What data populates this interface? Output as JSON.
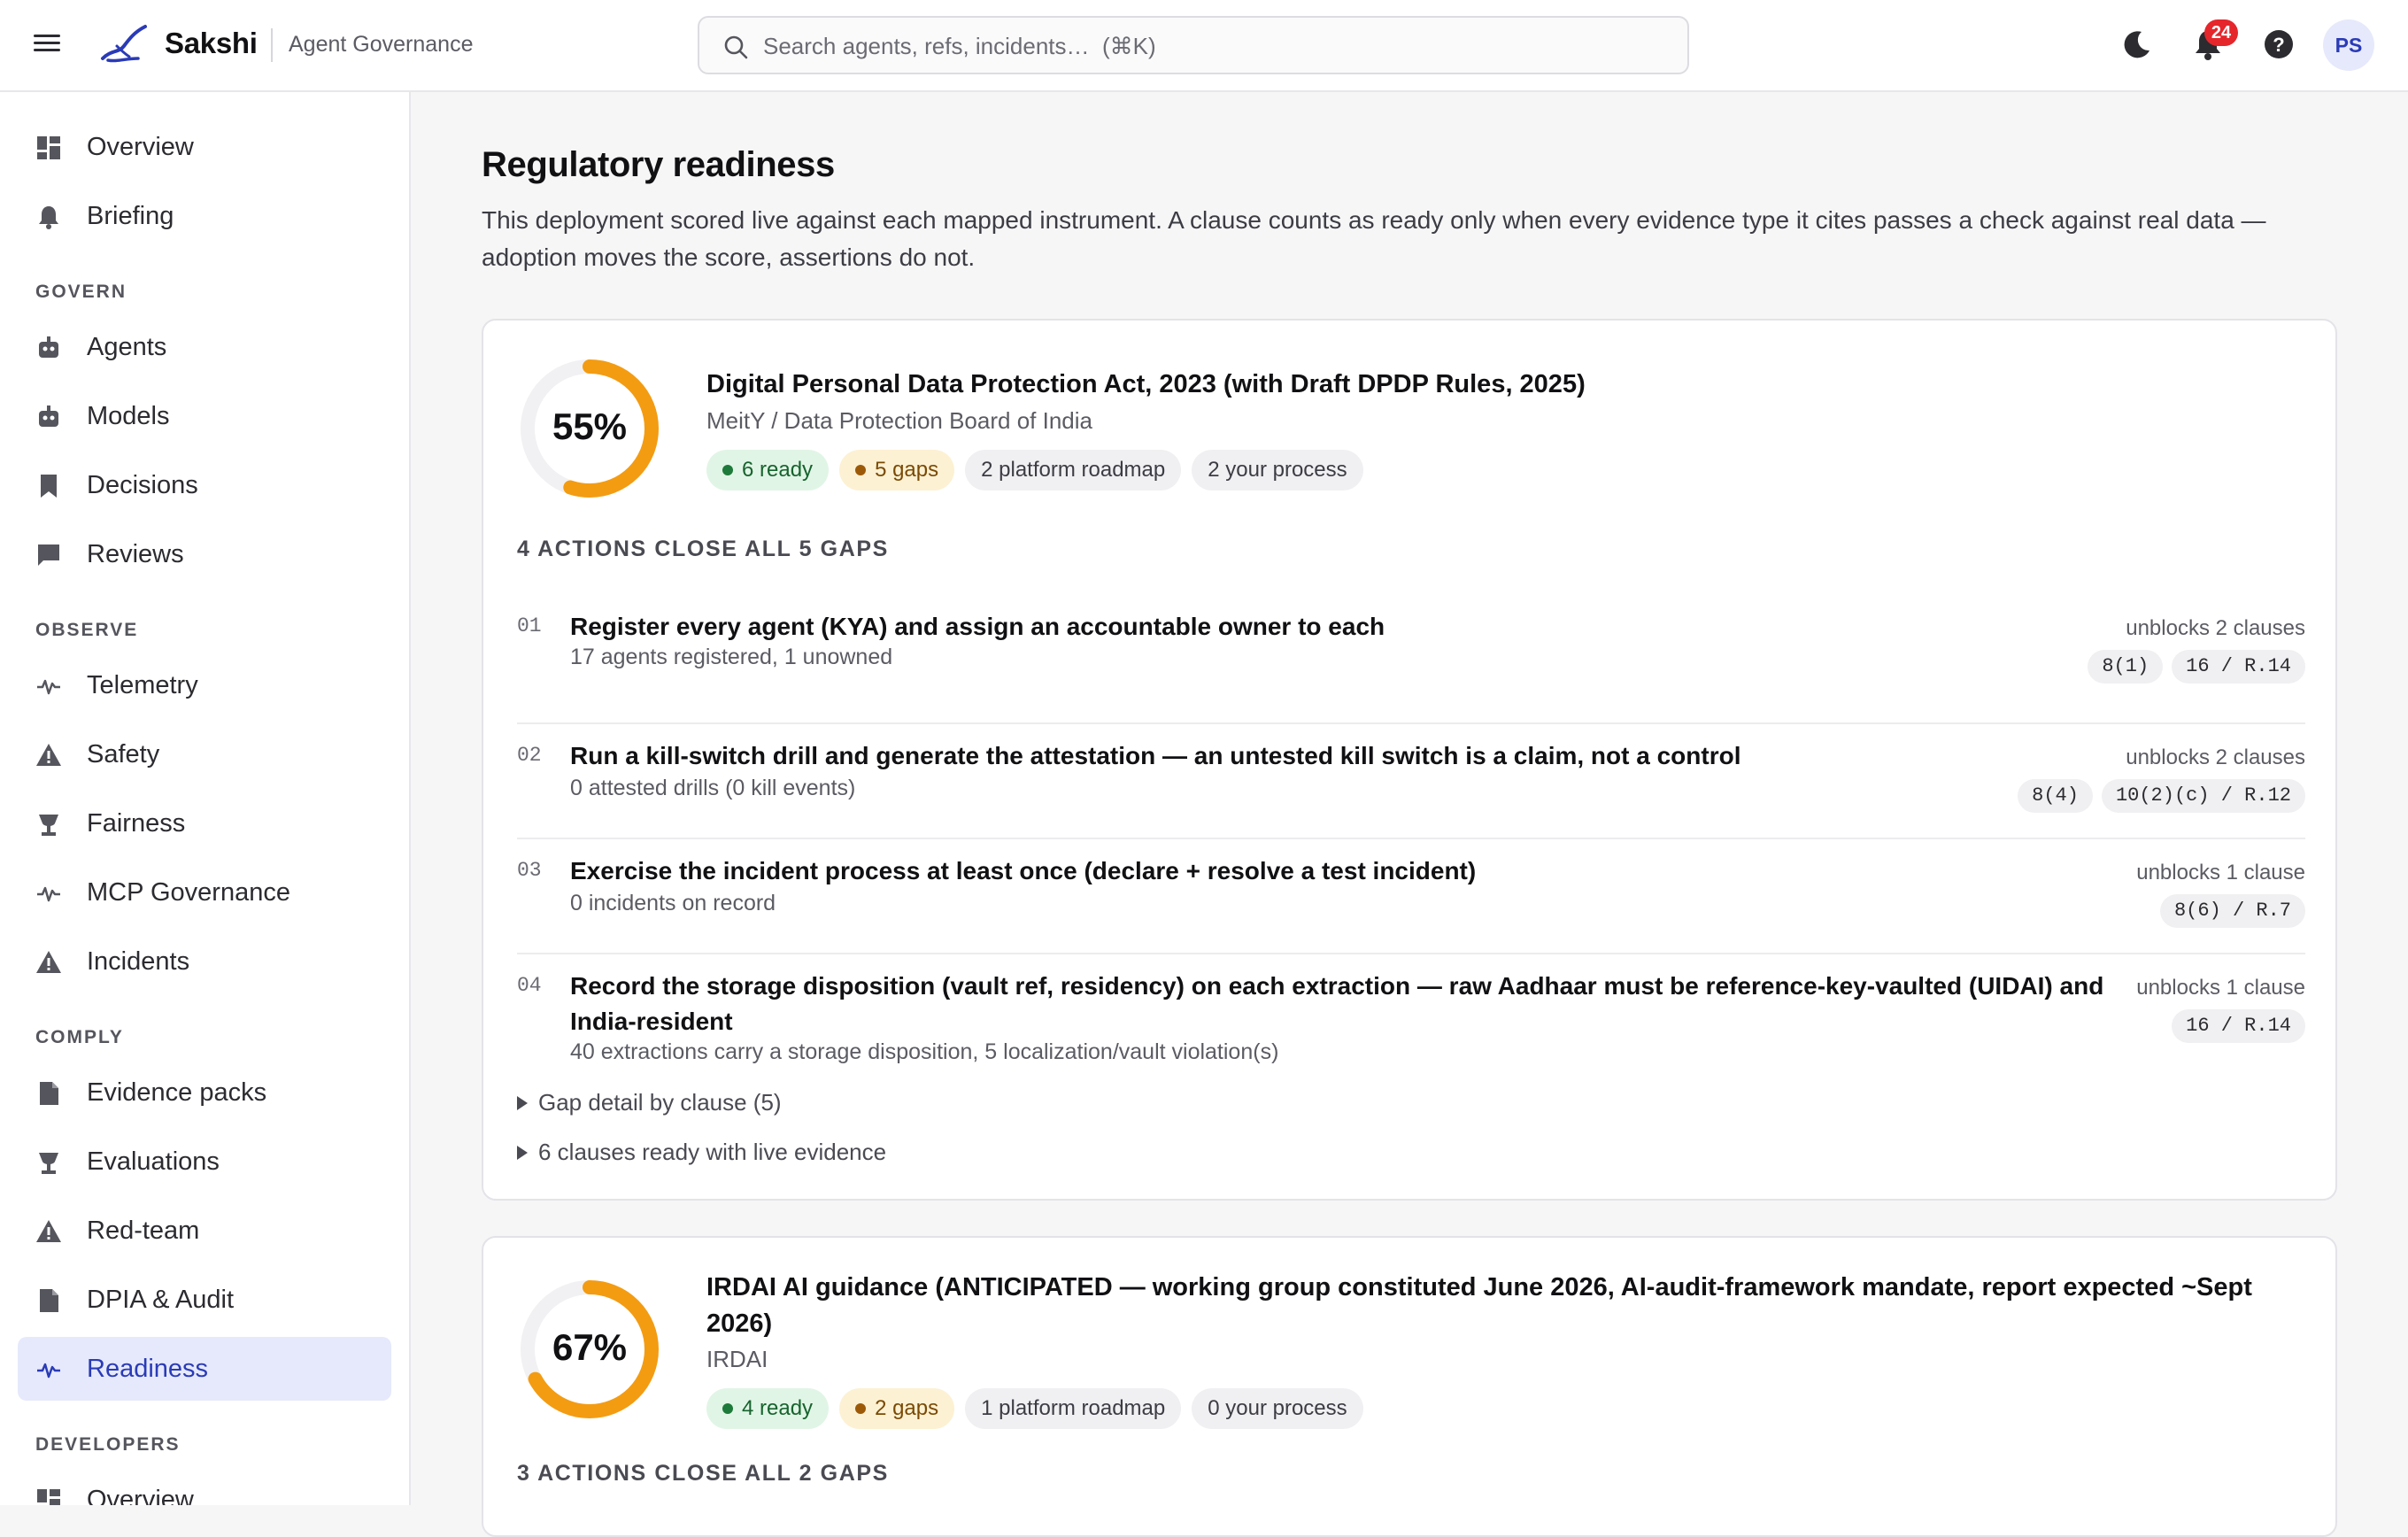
{
  "app": {
    "brand": "Sakshi",
    "subtitle": "Agent Governance"
  },
  "search": {
    "placeholder": "Search agents, refs, incidents…  (⌘K)"
  },
  "topbar": {
    "notification_count": "24",
    "avatar_initials": "PS"
  },
  "sidebar": {
    "top_items": [
      {
        "label": "Overview",
        "icon": "dashboard-icon"
      },
      {
        "label": "Briefing",
        "icon": "bell-icon"
      }
    ],
    "sections": [
      {
        "title": "GOVERN",
        "items": [
          {
            "label": "Agents",
            "icon": "robot-icon"
          },
          {
            "label": "Models",
            "icon": "robot-icon"
          },
          {
            "label": "Decisions",
            "icon": "bookmark-icon"
          },
          {
            "label": "Reviews",
            "icon": "comment-icon"
          }
        ]
      },
      {
        "title": "OBSERVE",
        "items": [
          {
            "label": "Telemetry",
            "icon": "pulse-icon"
          },
          {
            "label": "Safety",
            "icon": "warning-icon"
          },
          {
            "label": "Fairness",
            "icon": "scale-icon"
          },
          {
            "label": "MCP Governance",
            "icon": "pulse-icon"
          },
          {
            "label": "Incidents",
            "icon": "warning-icon"
          }
        ]
      },
      {
        "title": "COMPLY",
        "items": [
          {
            "label": "Evidence packs",
            "icon": "document-icon"
          },
          {
            "label": "Evaluations",
            "icon": "scale-icon"
          },
          {
            "label": "Red-team",
            "icon": "warning-icon"
          },
          {
            "label": "DPIA & Audit",
            "icon": "document-icon"
          },
          {
            "label": "Readiness",
            "icon": "pulse-icon",
            "active": true
          }
        ]
      },
      {
        "title": "DEVELOPERS",
        "items": [
          {
            "label": "Overview",
            "icon": "dashboard-icon"
          }
        ]
      }
    ]
  },
  "page": {
    "title": "Regulatory readiness",
    "description": "This deployment scored live against each mapped instrument. A clause counts as ready only when every evidence type it cites passes a check against real data — adoption moves the score, assertions do not."
  },
  "colors": {
    "accent": "#2a3bb7",
    "donut_fill": "#f39c12",
    "donut_track": "#f1f1f3",
    "ready": "#1e7a3a",
    "gap": "#9c5a08"
  },
  "instruments": [
    {
      "percent_label": "55%",
      "percent": 55,
      "title": "Digital Personal Data Protection Act, 2023 (with Draft DPDP Rules, 2025)",
      "issuer": "MeitY / Data Protection Board of India",
      "pills": {
        "ready": "6 ready",
        "gaps": "5 gaps",
        "roadmap": "2 platform roadmap",
        "process": "2 your process"
      },
      "actions_heading": "4 ACTIONS CLOSE ALL 5 GAPS",
      "actions": [
        {
          "num": "01",
          "title": "Register every agent (KYA) and assign an accountable owner to each",
          "sub": "17 agents registered, 1 unowned",
          "unblocks": "unblocks 2 clauses",
          "chips": [
            "8(1)",
            "16 / R.14"
          ]
        },
        {
          "num": "02",
          "title": "Run a kill-switch drill and generate the attestation — an untested kill switch is a claim, not a control",
          "sub": "0 attested drills (0 kill events)",
          "unblocks": "unblocks 2 clauses",
          "chips": [
            "8(4)",
            "10(2)(c) / R.12"
          ]
        },
        {
          "num": "03",
          "title": "Exercise the incident process at least once (declare + resolve a test incident)",
          "sub": "0 incidents on record",
          "unblocks": "unblocks 1 clause",
          "chips": [
            "8(6) / R.7"
          ]
        },
        {
          "num": "04",
          "title": "Record the storage disposition (vault ref, residency) on each extraction — raw Aadhaar must be reference-key-vaulted (UIDAI) and India-resident",
          "sub": "40 extractions carry a storage disposition, 5 localization/vault violation(s)",
          "unblocks": "unblocks 1 clause",
          "chips": [
            "16 / R.14"
          ]
        }
      ],
      "gap_detail": "Gap detail by clause (5)",
      "ready_detail": "6 clauses ready with live evidence"
    },
    {
      "percent_label": "67%",
      "percent": 67,
      "title": "IRDAI AI guidance (ANTICIPATED — working group constituted June 2026, AI-audit-framework mandate, report expected ~Sept 2026)",
      "issuer": "IRDAI",
      "pills": {
        "ready": "4 ready",
        "gaps": "2 gaps",
        "roadmap": "1 platform roadmap",
        "process": "0 your process"
      },
      "actions_heading": "3 ACTIONS CLOSE ALL 2 GAPS"
    }
  ]
}
